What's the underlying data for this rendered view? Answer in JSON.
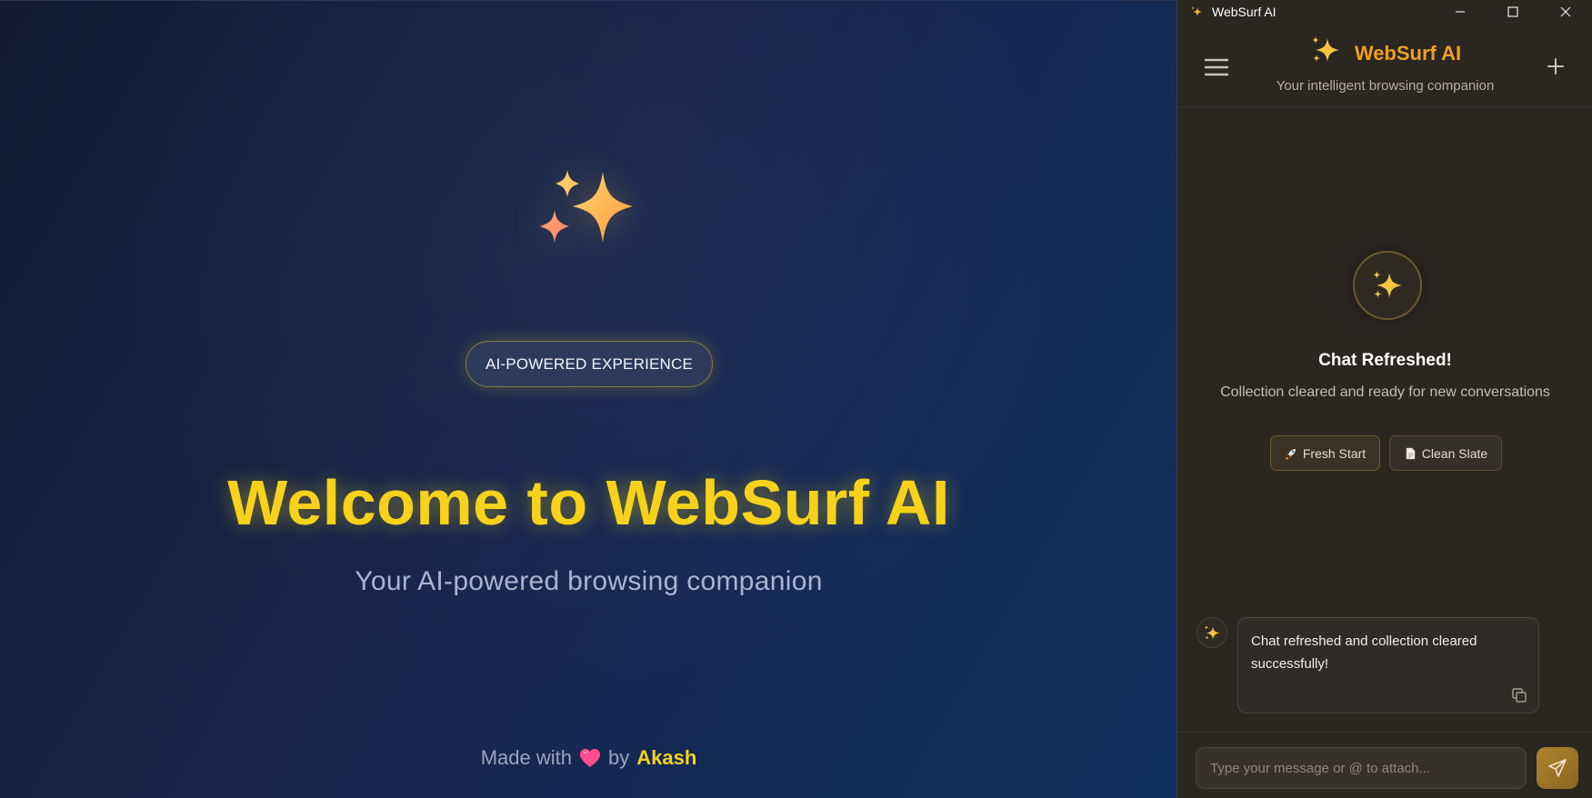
{
  "welcome": {
    "badge": "AI-POWERED EXPERIENCE",
    "title": "Welcome to WebSurf AI",
    "subtitle": "Your AI-powered browsing companion",
    "credit_prefix": "Made with",
    "credit_by": "by",
    "credit_author": "Akash",
    "hero_icon": "sparkles-icon",
    "heart_icon": "heart-icon"
  },
  "window": {
    "title": "WebSurf AI",
    "controls": [
      "minimize",
      "maximize",
      "close"
    ]
  },
  "panel": {
    "brand_name": "WebSurf AI",
    "tagline": "Your intelligent browsing companion",
    "refresh_title": "Chat Refreshed!",
    "refresh_subtitle": "Collection cleared and ready for new conversations",
    "chips": [
      {
        "label": "Fresh Start",
        "icon": "rocket-icon"
      },
      {
        "label": "Clean Slate",
        "icon": "document-icon"
      }
    ],
    "messages": [
      {
        "role": "assistant",
        "text": "Chat refreshed and collection cleared successfully!"
      }
    ],
    "input_placeholder": "Type your message or @ to attach...",
    "input_value": ""
  },
  "colors": {
    "accent_yellow": "#f6d21a",
    "brand_orange": "#f0a020",
    "panel_bg": "#2a2620",
    "page_bg": "#16254a"
  }
}
